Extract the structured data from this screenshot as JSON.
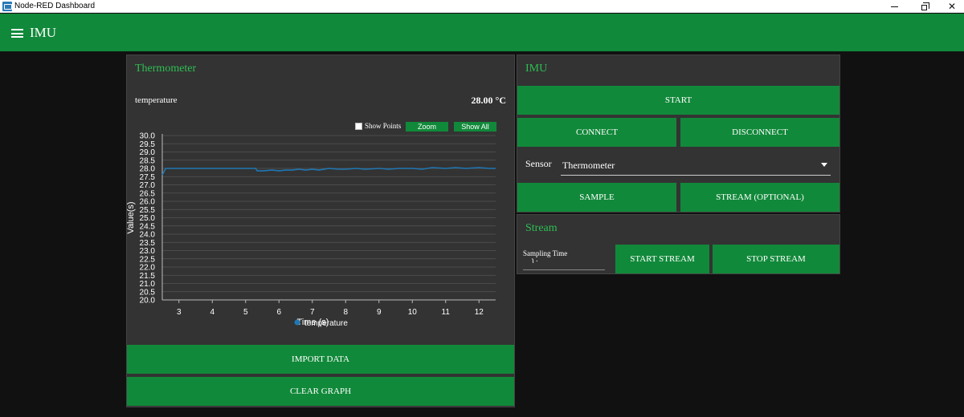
{
  "window": {
    "title": "Node-RED Dashboard",
    "minimize": "—",
    "maximize": "❐",
    "close": "✕"
  },
  "header": {
    "title": "IMU"
  },
  "thermometer": {
    "title": "Thermometer",
    "gauge_label": "temperature",
    "gauge_value": "28.00 °C",
    "show_points_label": "Show Points",
    "zoom_label": "Zoom",
    "show_all_label": "Show All",
    "import_label": "IMPORT DATA",
    "clear_label": "CLEAR GRAPH"
  },
  "imu": {
    "title": "IMU",
    "start_label": "START",
    "connect_label": "CONNECT",
    "disconnect_label": "DISCONNECT",
    "sensor_label": "Sensor",
    "sensor_value": "Thermometer",
    "sample_label": "SAMPLE",
    "stream_label": "STREAM (OPTIONAL)"
  },
  "stream": {
    "title": "Stream",
    "sampling_label": "Sampling Time",
    "sampling_value": "١٠",
    "start_label": "START STREAM",
    "stop_label": "STOP STREAM"
  },
  "colors": {
    "accent": "#11893a",
    "title_green": "#2dbf52",
    "card": "#333333",
    "background": "#111111",
    "series": "#1f77b4"
  },
  "chart_data": {
    "type": "line",
    "xlabel": "Time (s)",
    "ylabel": "Value(s)",
    "xlim": [
      2.5,
      12.5
    ],
    "ylim": [
      20.0,
      30.0
    ],
    "xticks": [
      3,
      4,
      5,
      6,
      7,
      8,
      9,
      10,
      11,
      12
    ],
    "yticks": [
      "20.0",
      "20.5",
      "21.0",
      "21.5",
      "22.0",
      "22.5",
      "23.0",
      "23.5",
      "24.0",
      "24.5",
      "25.0",
      "25.5",
      "26.0",
      "26.5",
      "27.0",
      "27.5",
      "28.0",
      "28.5",
      "29.0",
      "29.5",
      "30.0"
    ],
    "grid": true,
    "legend": "bottom-center",
    "series": [
      {
        "name": "temperature",
        "x": [
          2.5,
          2.6,
          2.7,
          3.0,
          3.5,
          4.0,
          4.5,
          5.0,
          5.3,
          5.35,
          5.5,
          5.8,
          6.0,
          6.2,
          6.4,
          6.6,
          6.8,
          7.0,
          7.2,
          7.5,
          7.8,
          8.0,
          8.3,
          8.6,
          9.0,
          9.3,
          9.6,
          10.0,
          10.3,
          10.6,
          11.0,
          11.3,
          11.6,
          12.0,
          12.3,
          12.5
        ],
        "y": [
          27.6,
          28.0,
          28.0,
          28.0,
          28.0,
          28.0,
          28.0,
          28.0,
          28.0,
          27.85,
          27.85,
          27.9,
          27.85,
          27.9,
          27.9,
          27.95,
          27.9,
          27.95,
          27.9,
          28.0,
          27.95,
          27.95,
          28.0,
          27.95,
          28.0,
          27.95,
          28.0,
          28.0,
          27.95,
          28.05,
          28.0,
          28.05,
          28.0,
          28.05,
          28.0,
          28.0
        ]
      }
    ]
  }
}
